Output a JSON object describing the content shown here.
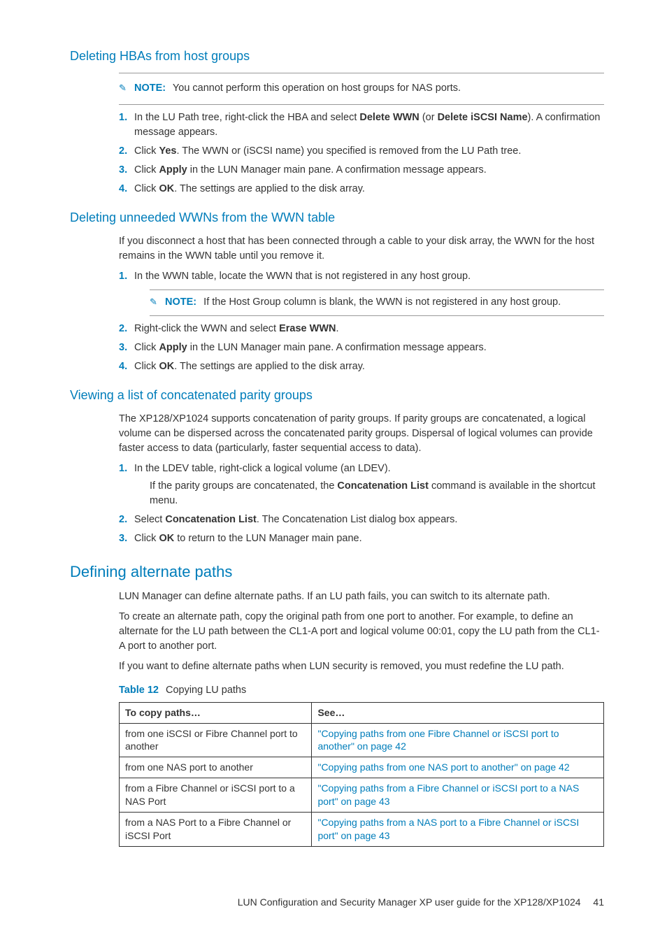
{
  "heading_h1": "Deleting HBAs from host groups",
  "note1_label": "NOTE:",
  "note1_text": "You cannot perform this operation on host groups for NAS ports.",
  "steps_a": [
    {
      "n": "1.",
      "t": "In the LU Path tree, right-click the HBA and select <b>Delete WWN</b> (or <b>Delete iSCSI Name</b>). A confirmation message appears."
    },
    {
      "n": "2.",
      "t": "Click <b>Yes</b>. The WWN or (iSCSI name) you specified is removed from the LU Path tree."
    },
    {
      "n": "3.",
      "t": "Click <b>Apply</b> in the LUN Manager main pane. A confirmation message appears."
    },
    {
      "n": "4.",
      "t": "Click <b>OK</b>. The settings are applied to the disk array."
    }
  ],
  "heading_h2": "Deleting unneeded WWNs from the WWN table",
  "para_b": "If you disconnect a host that has been connected through a cable to your disk array, the WWN for the host remains in the WWN table until you remove it.",
  "steps_b1": [
    {
      "n": "1.",
      "t": "In the WWN table, locate the WWN that is not registered in any host group."
    }
  ],
  "note2_label": "NOTE:",
  "note2_text": "If the Host Group column is blank, the WWN is not registered in any host group.",
  "steps_b2": [
    {
      "n": "2.",
      "t": "Right-click the WWN and select <b>Erase WWN</b>."
    },
    {
      "n": "3.",
      "t": "Click <b>Apply</b> in the LUN Manager main pane. A confirmation message appears."
    },
    {
      "n": "4.",
      "t": "Click <b>OK</b>. The settings are applied to the disk array."
    }
  ],
  "heading_h3": "Viewing a list of concatenated parity groups",
  "para_c": "The XP128/XP1024 supports concatenation of parity groups. If parity groups are concatenated, a logical volume can be dispersed across the concatenated parity groups. Dispersal of logical volumes can provide faster access to data (particularly, faster sequential access to data).",
  "steps_c": [
    {
      "n": "1.",
      "t": "In the LDEV table, right-click a logical volume (an LDEV).",
      "sub": "If the parity groups are concatenated, the <b>Concatenation List</b> command is available in the shortcut menu."
    },
    {
      "n": "2.",
      "t": "Select <b>Concatenation List</b>. The Concatenation List dialog box appears."
    },
    {
      "n": "3.",
      "t": "Click <b>OK</b> to return to the LUN Manager main pane."
    }
  ],
  "heading_h4": "Defining alternate paths",
  "para_d1": "LUN Manager can define alternate paths. If an LU path fails, you can switch to its alternate path.",
  "para_d2": "To create an alternate path, copy the original path from one port to another. For example, to define an alternate for the LU path between the CL1-A port and logical volume 00:01, copy the LU path from the CL1-A port to another port.",
  "para_d3": "If you want to define alternate paths when LUN security is removed, you must redefine the LU path.",
  "table_label": "Table 12",
  "table_caption": "Copying LU paths",
  "th_left": "To copy paths…",
  "th_right": "See…",
  "rows": [
    {
      "l": "from one iSCSI or Fibre Channel port to another",
      "r": "\"Copying paths from one Fibre Channel or iSCSI port to another\" on page 42"
    },
    {
      "l": "from one NAS port to another",
      "r": "\"Copying paths from one NAS port to another\" on page 42"
    },
    {
      "l": "from a Fibre Channel or iSCSI port to a NAS Port",
      "r": "\"Copying paths from a Fibre Channel or iSCSI port to a NAS port\" on page 43"
    },
    {
      "l": "from a NAS Port to a Fibre Channel or iSCSI Port",
      "r": "\"Copying paths from a NAS port to a Fibre Channel or iSCSI port\" on page 43"
    }
  ],
  "footer_text": "LUN Configuration and Security Manager XP user guide for the XP128/XP1024",
  "footer_page": "41"
}
